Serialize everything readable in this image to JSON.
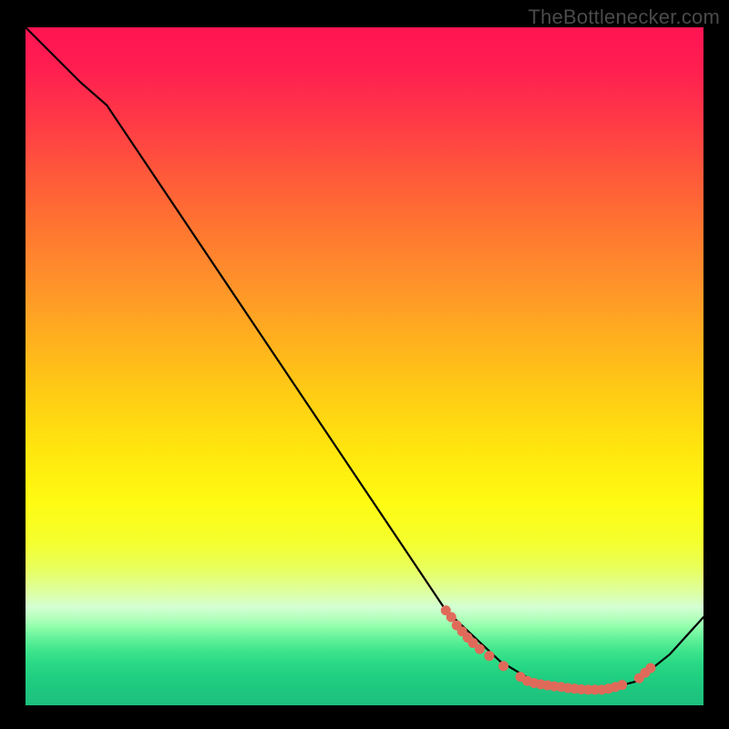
{
  "watermark": "TheBottlenecker.com",
  "chart_data": {
    "type": "line",
    "title": "",
    "xlabel": "",
    "ylabel": "",
    "xlim": [
      0,
      100
    ],
    "ylim": [
      0,
      100
    ],
    "background": "rainbow-vertical-gradient",
    "series": [
      {
        "name": "bottleneck-curve",
        "color": "#000000",
        "x": [
          0,
          8,
          12,
          62,
          70,
          75,
          80,
          85,
          90,
          95,
          100
        ],
        "y": [
          100,
          92,
          88.5,
          14,
          6.5,
          3.5,
          2.4,
          2.2,
          3.5,
          7.5,
          13
        ]
      }
    ],
    "markers": {
      "name": "highlight-points",
      "color": "#e06a5a",
      "radius": 5.5,
      "points": [
        {
          "x": 62.0,
          "y": 14.0
        },
        {
          "x": 62.8,
          "y": 13.0
        },
        {
          "x": 63.6,
          "y": 11.8
        },
        {
          "x": 64.4,
          "y": 10.9
        },
        {
          "x": 65.2,
          "y": 10.0
        },
        {
          "x": 66.0,
          "y": 9.2
        },
        {
          "x": 67.0,
          "y": 8.3
        },
        {
          "x": 68.4,
          "y": 7.3
        },
        {
          "x": 70.5,
          "y": 5.8
        },
        {
          "x": 73.0,
          "y": 4.2
        },
        {
          "x": 74.0,
          "y": 3.6
        },
        {
          "x": 75.0,
          "y": 3.3
        },
        {
          "x": 76.0,
          "y": 3.1
        },
        {
          "x": 77.0,
          "y": 2.95
        },
        {
          "x": 78.0,
          "y": 2.8
        },
        {
          "x": 79.0,
          "y": 2.7
        },
        {
          "x": 80.0,
          "y": 2.55
        },
        {
          "x": 81.0,
          "y": 2.45
        },
        {
          "x": 82.0,
          "y": 2.35
        },
        {
          "x": 83.0,
          "y": 2.3
        },
        {
          "x": 84.0,
          "y": 2.3
        },
        {
          "x": 85.0,
          "y": 2.3
        },
        {
          "x": 86.0,
          "y": 2.45
        },
        {
          "x": 87.0,
          "y": 2.7
        },
        {
          "x": 88.0,
          "y": 3.0
        },
        {
          "x": 90.5,
          "y": 4.0
        },
        {
          "x": 91.4,
          "y": 4.8
        },
        {
          "x": 92.2,
          "y": 5.5
        }
      ]
    }
  }
}
